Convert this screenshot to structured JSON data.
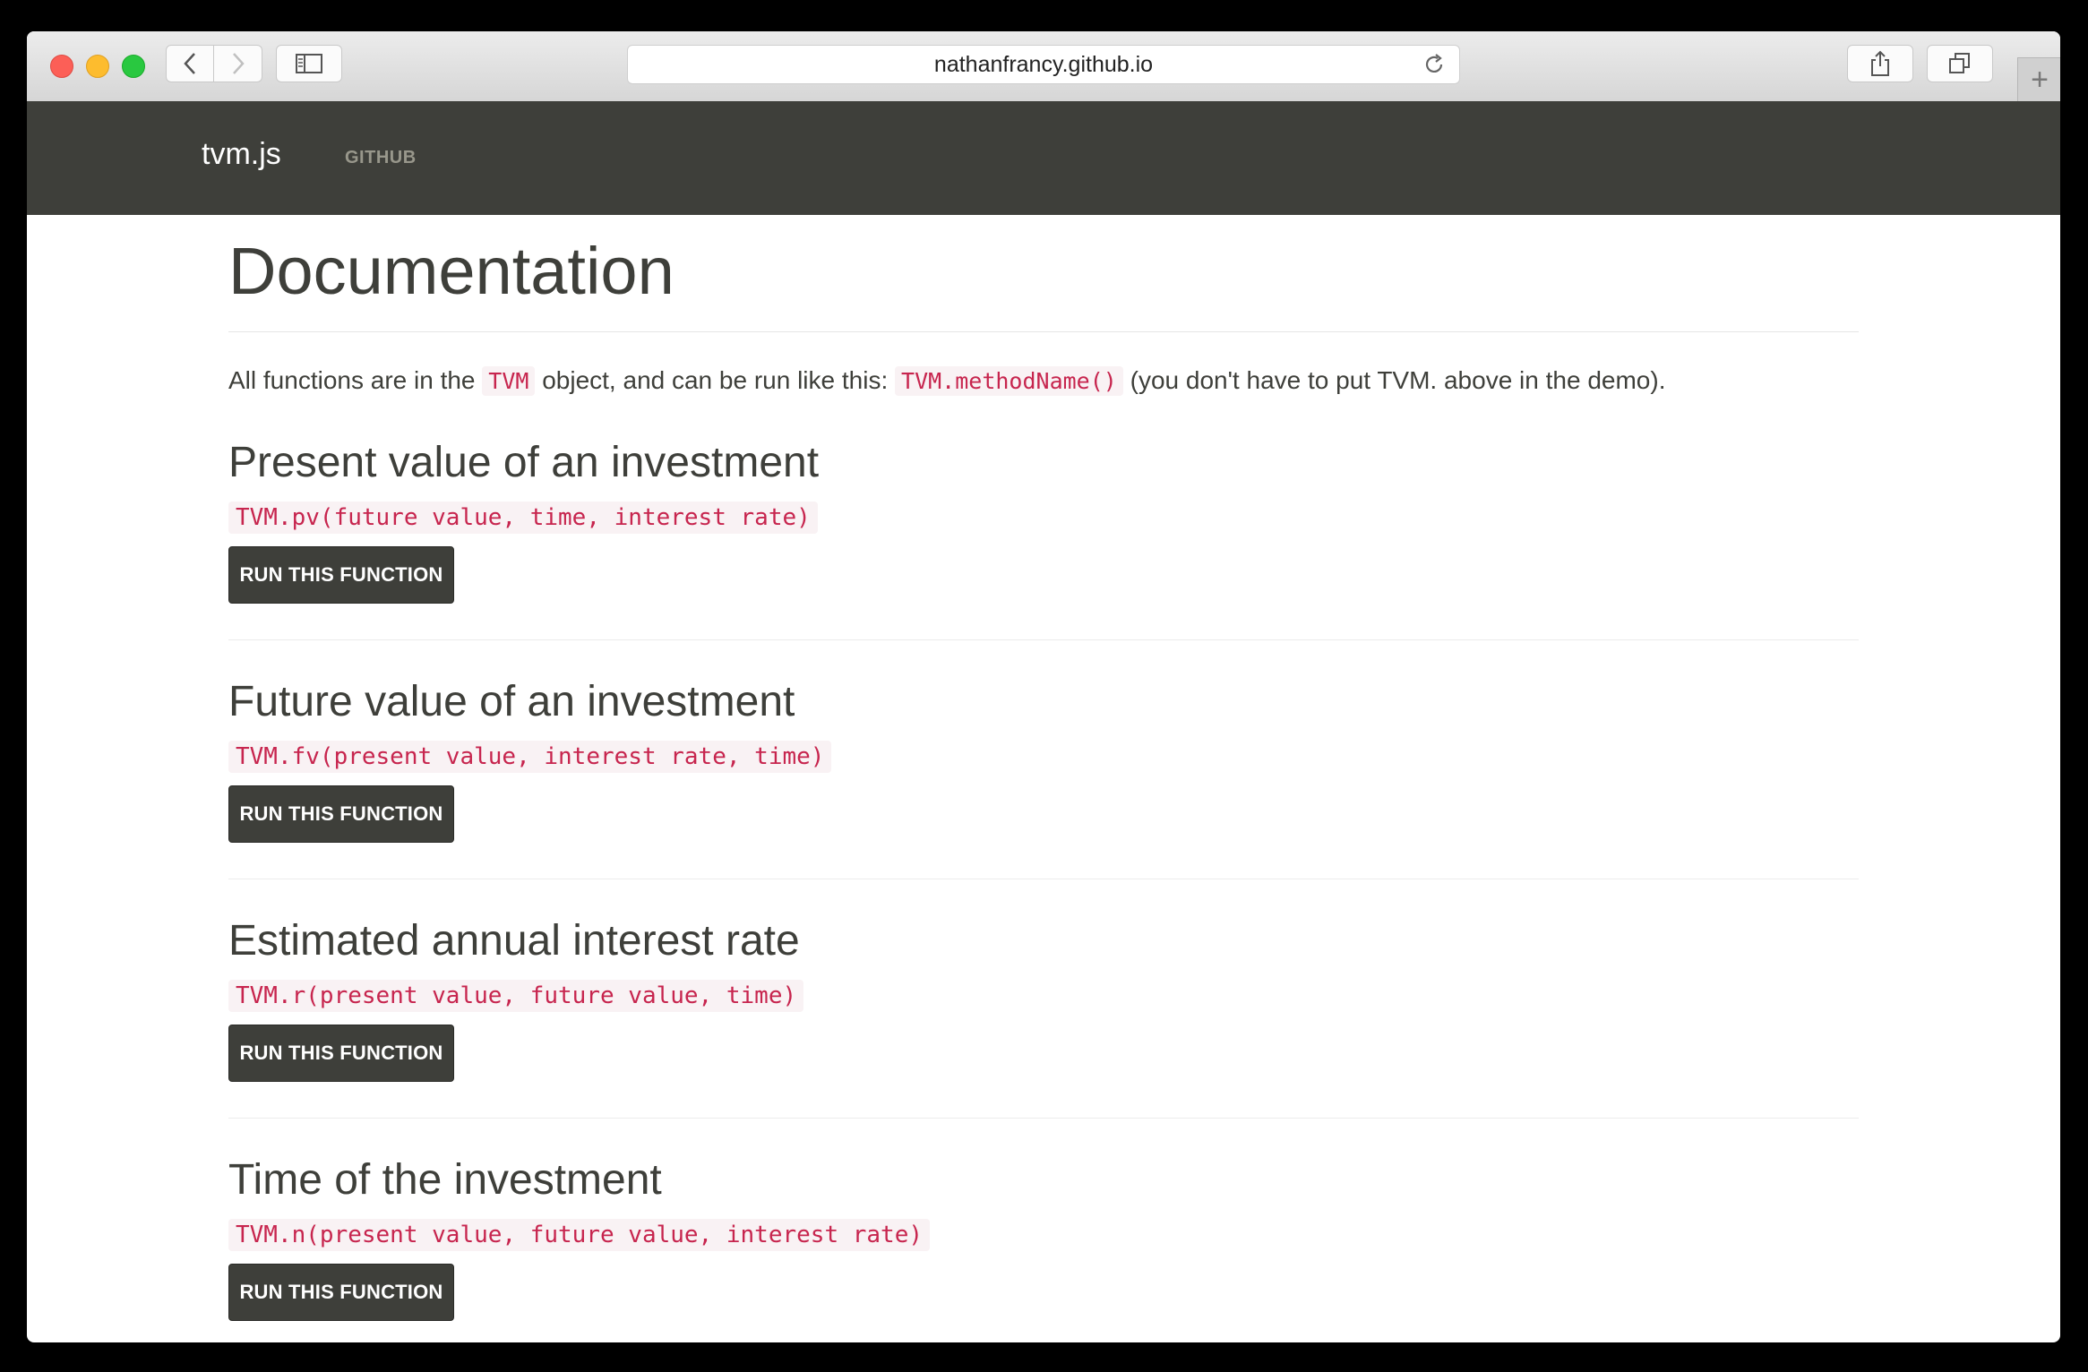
{
  "browser": {
    "url": "nathanfrancy.github.io"
  },
  "nav": {
    "brand": "tvm.js",
    "link": "GITHUB"
  },
  "page": {
    "title": "Documentation",
    "intro_before": "All functions are in the ",
    "intro_code1": "TVM",
    "intro_middle": " object, and can be run like this: ",
    "intro_code2": "TVM.methodName()",
    "intro_after": " (you don't have to put TVM. above in the demo)."
  },
  "sections": [
    {
      "title": "Present value of an investment",
      "signature": "TVM.pv(future value, time, interest rate)",
      "button": "RUN THIS FUNCTION"
    },
    {
      "title": "Future value of an investment",
      "signature": "TVM.fv(present value, interest rate, time)",
      "button": "RUN THIS FUNCTION"
    },
    {
      "title": "Estimated annual interest rate",
      "signature": "TVM.r(present value, future value, time)",
      "button": "RUN THIS FUNCTION"
    },
    {
      "title": "Time of the investment",
      "signature": "TVM.n(present value, future value, interest rate)",
      "button": "RUN THIS FUNCTION"
    }
  ]
}
